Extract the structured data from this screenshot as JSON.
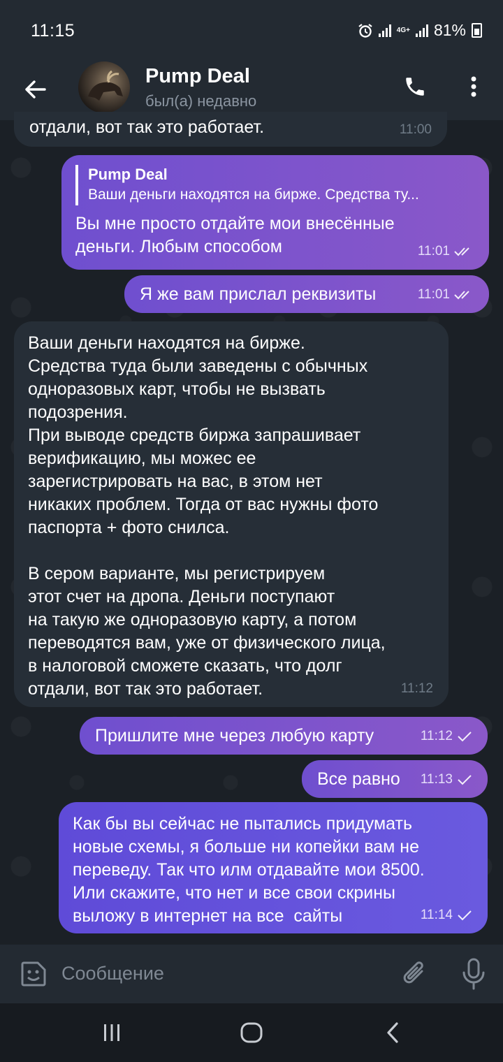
{
  "status_bar": {
    "time": "11:15",
    "network": "4G+",
    "battery": "81%",
    "icons": [
      "alarm-icon",
      "signal-icon",
      "network-4g-icon",
      "signal-icon",
      "battery-charging-icon"
    ]
  },
  "header": {
    "title": "Pump Deal",
    "status": "был(а) недавно",
    "icons": [
      "back-arrow-icon",
      "avatar",
      "phone-icon",
      "more-vertical-icon"
    ]
  },
  "messages": [
    {
      "direction": "in",
      "text": "отдали, вот так это работает.",
      "time": "11:00"
    },
    {
      "direction": "out",
      "reply_name": "Pump Deal",
      "reply_text": "Ваши деньги находятся на бирже. Средства ту...",
      "text": "Вы мне просто отдайте мои внесённые\nденьги. Любым способом",
      "time": "11:01",
      "status": "read"
    },
    {
      "direction": "out",
      "text": "Я же вам прислал реквизиты",
      "time": "11:01",
      "status": "read"
    },
    {
      "direction": "in",
      "text": "Ваши деньги находятся на бирже.\nСредства туда были заведены с обычных\nодноразовых карт, чтобы не вызвать\nподозрения.\nПри выводе средств биржа запрашивает\nверификацию, мы можес ее\nзарегистрировать на вас, в этом нет\nникаких проблем. Тогда от вас нужны фото\nпаспорта + фото снилса.\n\nВ сером варианте, мы регистрируем\nэтот счет на дропа. Деньги поступают\nна такую же одноразовую карту, а потом\nпереводятся вам, уже от физического лица,\nв налоговой сможете сказать, что долг\nотдали, вот так это работает.",
      "time": "11:12"
    },
    {
      "direction": "out",
      "text": "Пришлите мне через любую карту",
      "time": "11:12",
      "status": "sent"
    },
    {
      "direction": "out",
      "text": "Все равно",
      "time": "11:13",
      "status": "sent"
    },
    {
      "direction": "out",
      "text": "Как бы вы сейчас не пытались придумать\nновые схемы, я больше ни копейки вам не\nпереведу. Так что илм отдавайте мои 8500.\nИли скажите, что нет и все свои скрины\nвыложу в интернет на все  сайты",
      "time": "11:14",
      "status": "sent"
    }
  ],
  "input": {
    "placeholder": "Сообщение",
    "value": "",
    "icons": [
      "emoji-icon",
      "attach-icon",
      "mic-icon"
    ]
  },
  "nav_bar": {
    "icons": [
      "recent-apps-icon",
      "home-icon",
      "back-icon"
    ]
  },
  "colors": {
    "header_bg": "#232a32",
    "chat_bg": "#1b2026",
    "incoming_bubble": "#262e37",
    "outgoing_bubble_purple": "#8a58c9",
    "outgoing_bubble_blue": "#6a5adf",
    "secondary_text": "#8b95a1"
  }
}
